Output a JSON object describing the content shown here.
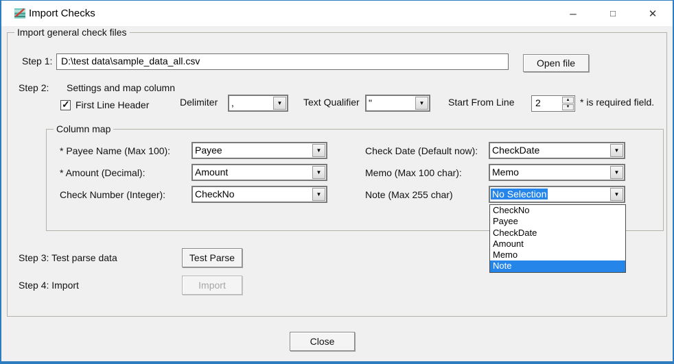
{
  "window": {
    "title": "Import Checks"
  },
  "icons": {
    "minimize": "–",
    "maximize": "□",
    "close": "✕",
    "checkmark": "✓",
    "combo_arrow": "▼",
    "spin_up": "▲",
    "spin_down": "▼"
  },
  "outer_group": {
    "title": "Import general check files"
  },
  "step1": {
    "label": "Step 1:",
    "file_path": "D:\\test data\\sample_data_all.csv",
    "open_button": "Open file"
  },
  "step2": {
    "label": "Step 2:",
    "title": "Settings and map column",
    "first_line_header": {
      "label": "First Line Header",
      "checked": true
    },
    "delimiter": {
      "label": "Delimiter",
      "value": ","
    },
    "text_qualifier": {
      "label": "Text Qualifier",
      "value": "\""
    },
    "start_from_line": {
      "label": "Start From Line",
      "value": "2"
    },
    "required_note": "* is required field."
  },
  "column_map": {
    "title": "Column map",
    "fields": [
      {
        "label": "* Payee Name (Max 100):",
        "value": "Payee"
      },
      {
        "label": "* Amount (Decimal):",
        "value": "Amount"
      },
      {
        "label": "Check Number (Integer):",
        "value": "CheckNo"
      },
      {
        "label": "Check Date (Default now):",
        "value": "CheckDate"
      },
      {
        "label": "Memo (Max 100 char):",
        "value": "Memo"
      },
      {
        "label": "Note  (Max 255 char)",
        "value": "No Selection"
      }
    ],
    "note_dropdown": {
      "options": [
        "CheckNo",
        "Payee",
        "CheckDate",
        "Amount",
        "Memo",
        "Note"
      ],
      "highlighted": "Note"
    }
  },
  "step3": {
    "label": "Step 3: Test parse data",
    "button": "Test Parse"
  },
  "step4": {
    "label": "Step 4: Import",
    "button": "Import",
    "enabled": false
  },
  "close_button": "Close",
  "colors": {
    "selection": "#2585e9",
    "window_border": "#2e7cc0",
    "titlebar_bg": "#ffffff",
    "body_bg": "#f0f0f0"
  }
}
